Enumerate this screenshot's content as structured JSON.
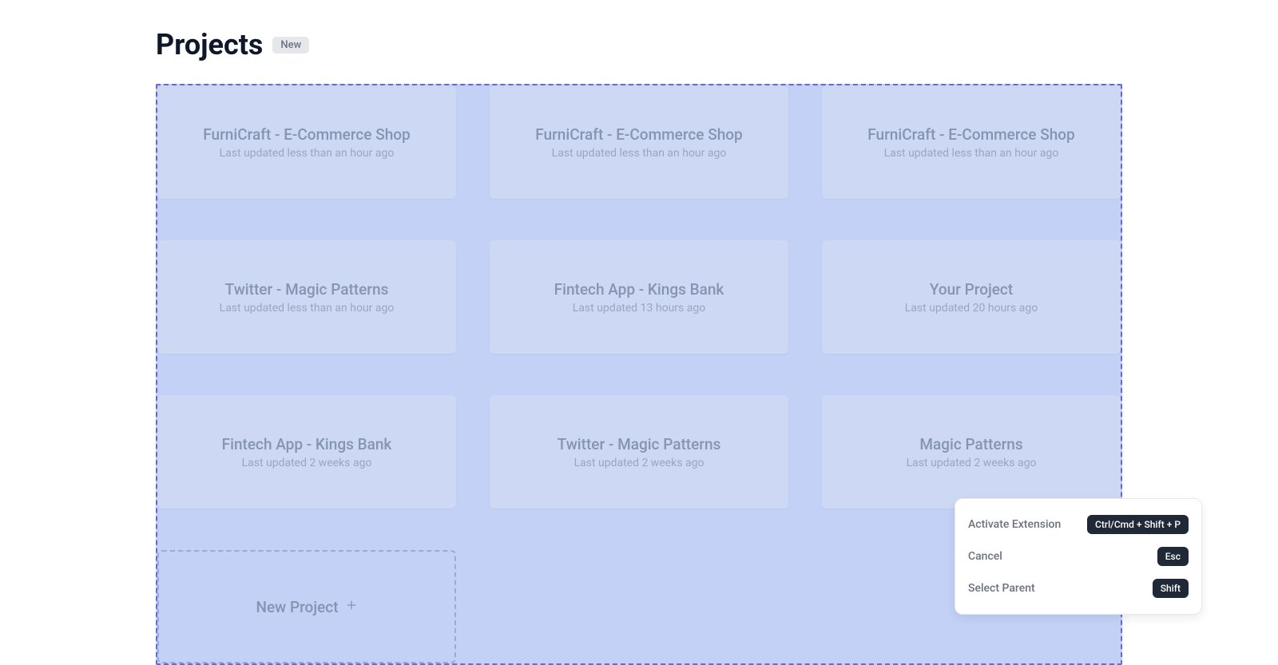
{
  "header": {
    "title": "Projects",
    "badge": "New"
  },
  "projects": [
    {
      "title": "FurniCraft - E-Commerce Shop",
      "subtitle": "Last updated less than an hour ago"
    },
    {
      "title": "FurniCraft - E-Commerce Shop",
      "subtitle": "Last updated less than an hour ago"
    },
    {
      "title": "FurniCraft - E-Commerce Shop",
      "subtitle": "Last updated less than an hour ago"
    },
    {
      "title": "Twitter - Magic Patterns",
      "subtitle": "Last updated less than an hour ago"
    },
    {
      "title": "Fintech App - Kings Bank",
      "subtitle": "Last updated 13 hours ago"
    },
    {
      "title": "Your Project",
      "subtitle": "Last updated 20 hours ago"
    },
    {
      "title": "Fintech App - Kings Bank",
      "subtitle": "Last updated 2 weeks ago"
    },
    {
      "title": "Twitter - Magic Patterns",
      "subtitle": "Last updated 2 weeks ago"
    },
    {
      "title": "Magic Patterns",
      "subtitle": "Last updated 2 weeks ago"
    }
  ],
  "newProject": {
    "label": "New Project"
  },
  "shortcuts": {
    "activate": {
      "label": "Activate Extension",
      "key": "Ctrl/Cmd + Shift + P"
    },
    "cancel": {
      "label": "Cancel",
      "key": "Esc"
    },
    "selectParent": {
      "label": "Select Parent",
      "key": "Shift"
    }
  }
}
